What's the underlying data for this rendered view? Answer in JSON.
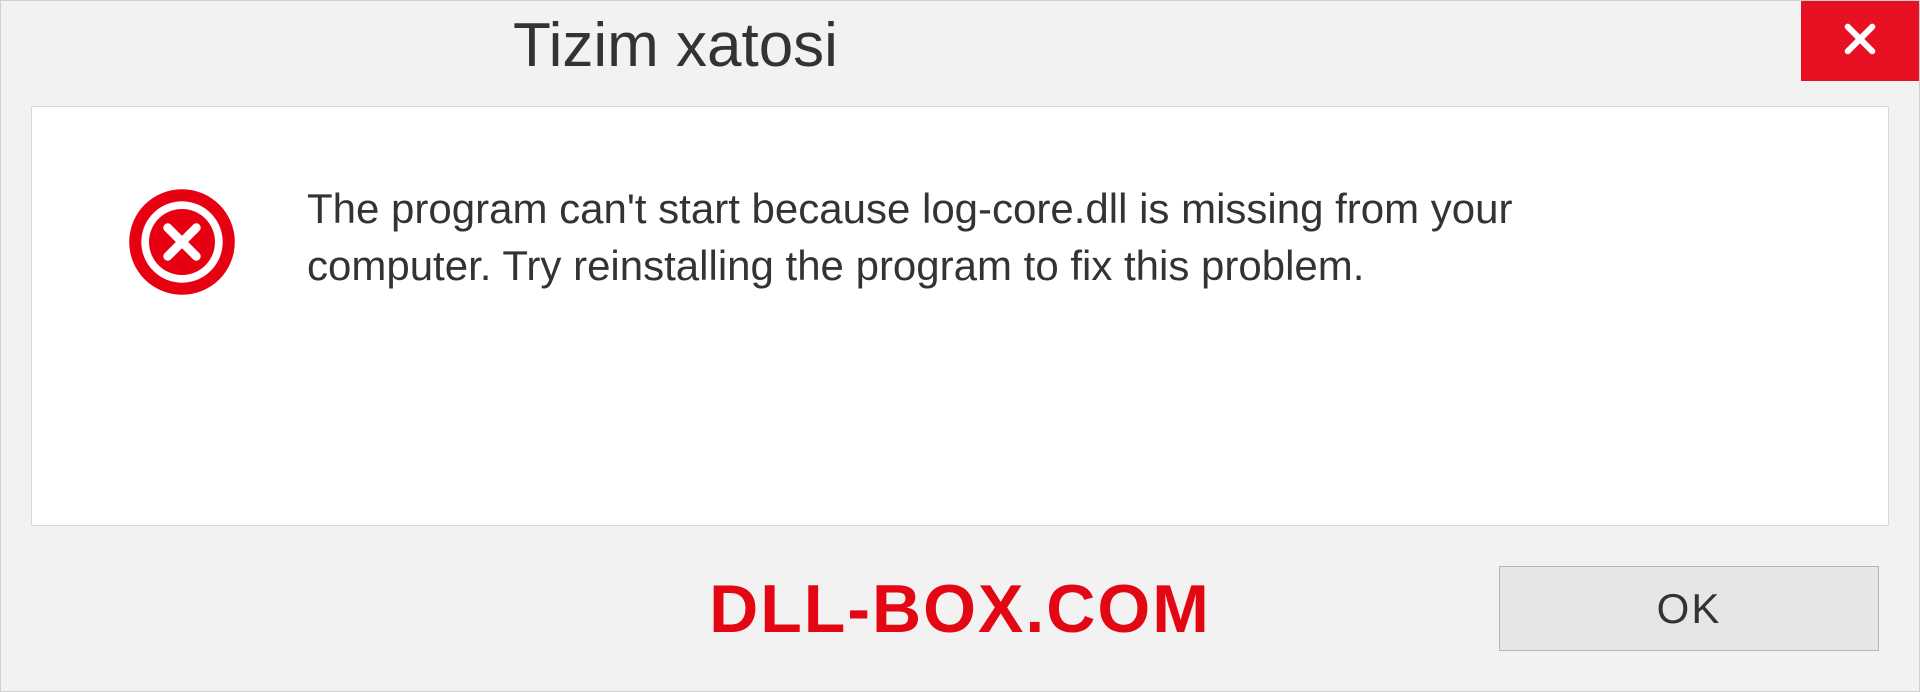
{
  "dialog": {
    "title": "Tizim xatosi",
    "message": "The program can't start because log-core.dll is missing from your computer. Try reinstalling the program to fix this problem.",
    "ok_label": "OK"
  },
  "watermark": "DLL-BOX.COM",
  "colors": {
    "close_button": "#e81123",
    "error_icon": "#e60012",
    "watermark": "#e30613"
  }
}
